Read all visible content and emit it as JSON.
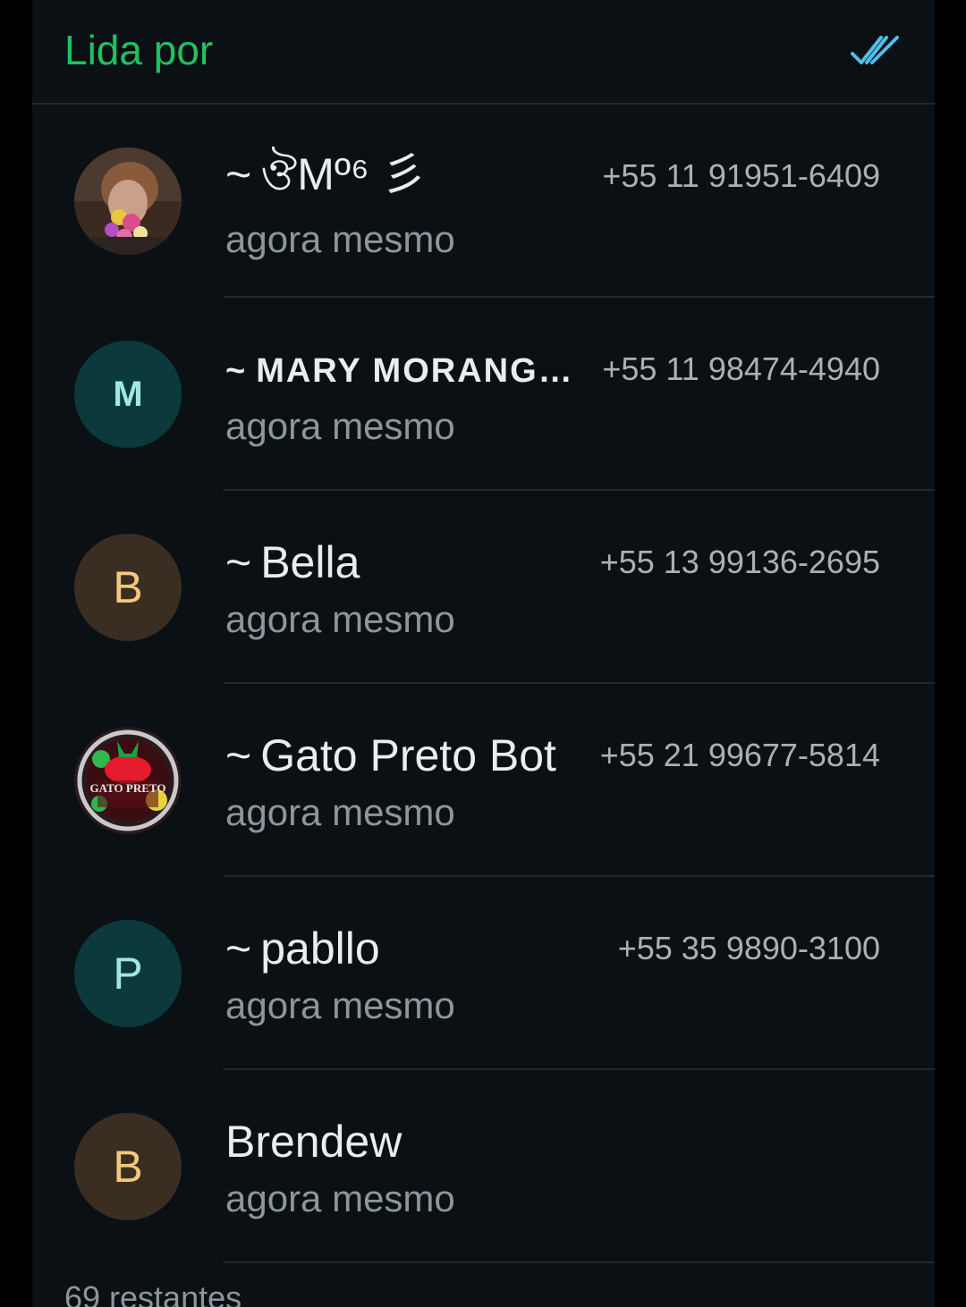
{
  "header": {
    "title": "Lida por",
    "read_icon": "double-check-icon",
    "accent_color": "#21c063",
    "check_color": "#53bdeb"
  },
  "readers": [
    {
      "prefix": "~",
      "name": "ঔMº⁶ 彡",
      "phone": "+55 11 91951-6409",
      "status": "agora mesmo",
      "avatar": {
        "type": "photo",
        "icon": "profile-photo-flowers"
      }
    },
    {
      "prefix": "~",
      "name": "MARY MORANG…",
      "phone": "+55 11 98474-4940",
      "status": "agora mesmo",
      "avatar": {
        "type": "initial",
        "letter": "M",
        "bg": "#0c3a3c",
        "fg": "#9fe8e0"
      }
    },
    {
      "prefix": "~",
      "name": "Bella",
      "phone": "+55 13 99136-2695",
      "status": "agora mesmo",
      "avatar": {
        "type": "initial",
        "letter": "B",
        "bg": "#3a2e23",
        "fg": "#f5c77e"
      }
    },
    {
      "prefix": "~",
      "name": "Gato Preto Bot",
      "phone": "+55 21 99677-5814",
      "status": "agora mesmo",
      "avatar": {
        "type": "logo",
        "icon": "gato-preto-logo",
        "logo_text": "GATO PRETO"
      }
    },
    {
      "prefix": "~",
      "name": "pabllo",
      "phone": "+55 35 9890-3100",
      "status": "agora mesmo",
      "avatar": {
        "type": "initial",
        "letter": "P",
        "bg": "#0c3a3c",
        "fg": "#9fe8e0"
      }
    },
    {
      "prefix": "",
      "name": "Brendew",
      "phone": "",
      "status": "agora mesmo",
      "avatar": {
        "type": "initial",
        "letter": "B",
        "bg": "#3a2e23",
        "fg": "#f5c77e"
      }
    }
  ],
  "footer": {
    "remaining": "69 restantes"
  }
}
